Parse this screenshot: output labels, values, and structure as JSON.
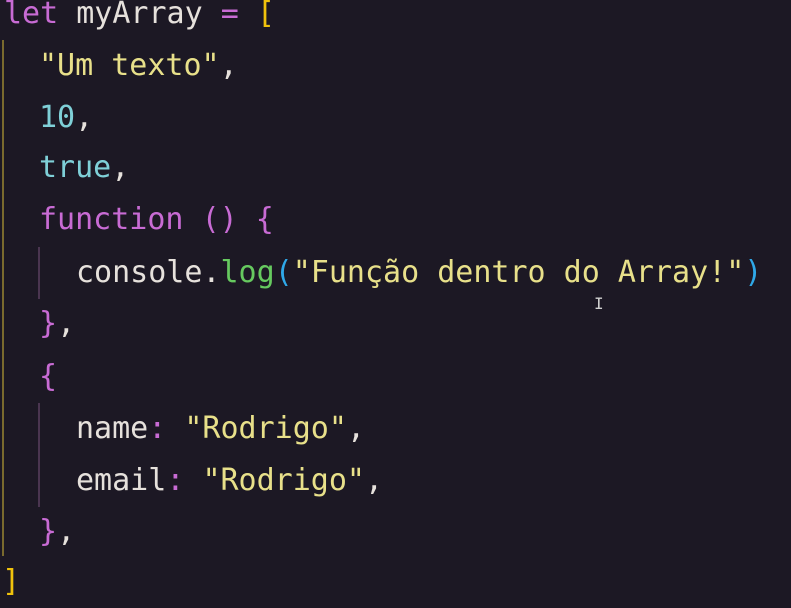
{
  "colors": {
    "background": "#1c1824",
    "keyword": "#c86bd4",
    "string": "#e8e08a",
    "number": "#7fd0d8",
    "boolean": "#7fd0d8",
    "plain": "#e6e1dc",
    "method": "#66c95f",
    "paren_inner": "#2fa8e8",
    "bracket_outer": "#f0c20c",
    "brace": "#c86bd4",
    "guide_outer": "#7a6a2e",
    "guide_inner": "#4a3550"
  },
  "code": {
    "l1_kw": "let",
    "l1_ident": " myArray ",
    "l1_op": "=",
    "l1_space": " ",
    "l1_bracket": "[",
    "l2_str": "\"Um texto\"",
    "l2_comma": ",",
    "l3_num": "10",
    "l3_comma": ",",
    "l4_bool": "true",
    "l4_comma": ",",
    "l5_kw": "function",
    "l5_sp1": " ",
    "l5_parens": "()",
    "l5_sp2": " ",
    "l5_brace": "{",
    "l6_obj": "console.",
    "l6_method": "log",
    "l6_popen": "(",
    "l6_str": "\"Função dentro do Array!\"",
    "l6_pclose": ")",
    "l7_brace": "}",
    "l7_comma": ",",
    "l8_brace": "{",
    "l9_key": "name",
    "l9_colon": ":",
    "l9_sp": " ",
    "l9_str": "\"Rodrigo\"",
    "l9_comma": ",",
    "l10_key": "email",
    "l10_colon": ":",
    "l10_sp": " ",
    "l10_str": "\"Rodrigo\"",
    "l10_comma": ",",
    "l11_brace": "}",
    "l11_comma": ",",
    "l12_bracket": "]"
  },
  "cursor_icon": "text-cursor-icon",
  "cursor_glyph": "I"
}
